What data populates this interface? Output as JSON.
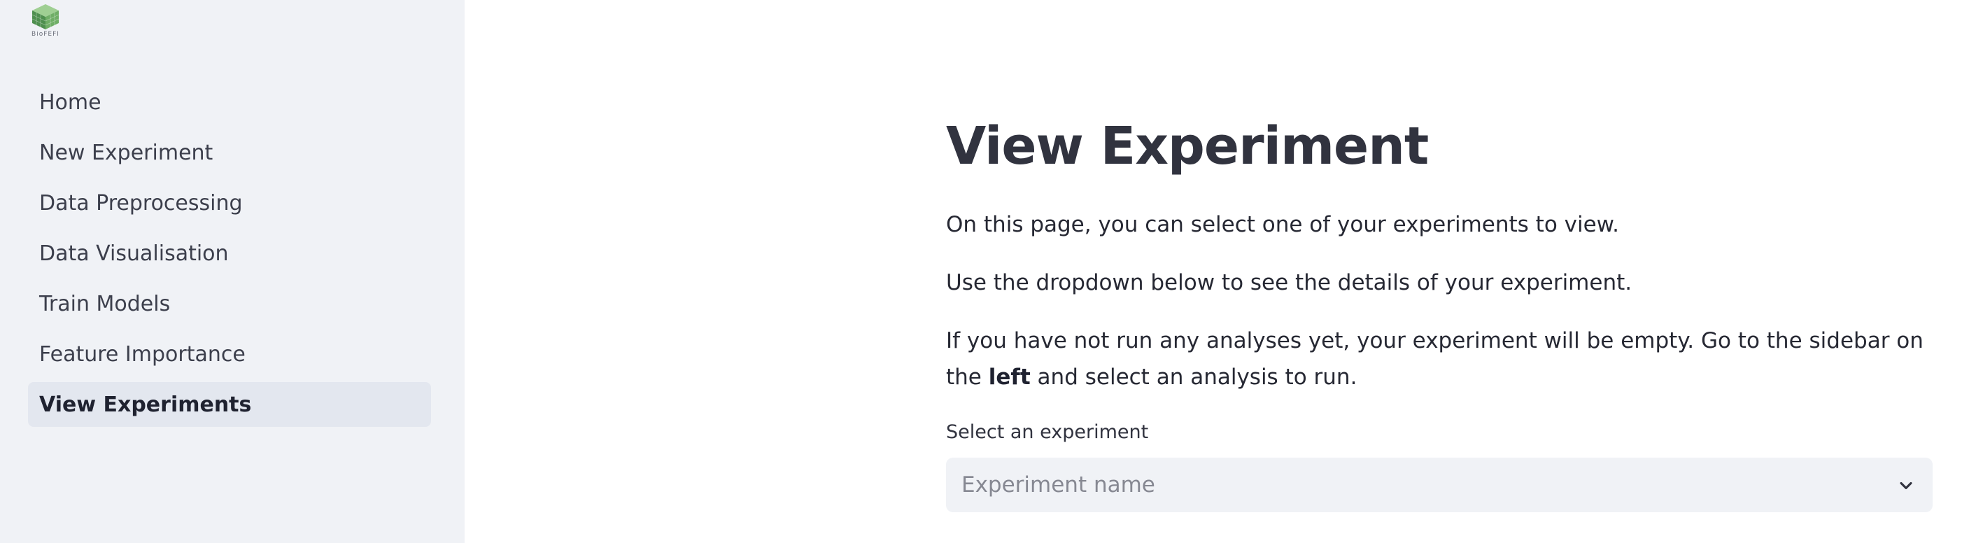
{
  "sidebar": {
    "logo_text": "BioFEFI",
    "items": [
      {
        "label": "Home",
        "active": false
      },
      {
        "label": "New Experiment",
        "active": false
      },
      {
        "label": "Data Preprocessing",
        "active": false
      },
      {
        "label": "Data Visualisation",
        "active": false
      },
      {
        "label": "Train Models",
        "active": false
      },
      {
        "label": "Feature Importance",
        "active": false
      },
      {
        "label": "View Experiments",
        "active": true
      }
    ]
  },
  "main": {
    "title": "View Experiment",
    "paragraph1": "On this page, you can select one of your experiments to view.",
    "paragraph2": "Use the dropdown below to see the details of your experiment.",
    "paragraph3_before": "If you have not run any analyses yet, your experiment will be empty. Go to the sidebar on the ",
    "paragraph3_bold": "left",
    "paragraph3_after": " and select an analysis to run.",
    "select": {
      "label": "Select an experiment",
      "placeholder": "Experiment name"
    }
  },
  "colors": {
    "sidebar_bg": "#f0f2f6",
    "active_item_bg": "#e3e7ef",
    "text": "#31333f",
    "logo_green": "#5aa35a"
  },
  "icons": {
    "logo": "cube-logo-icon",
    "select_arrow": "chevron-down-icon"
  }
}
